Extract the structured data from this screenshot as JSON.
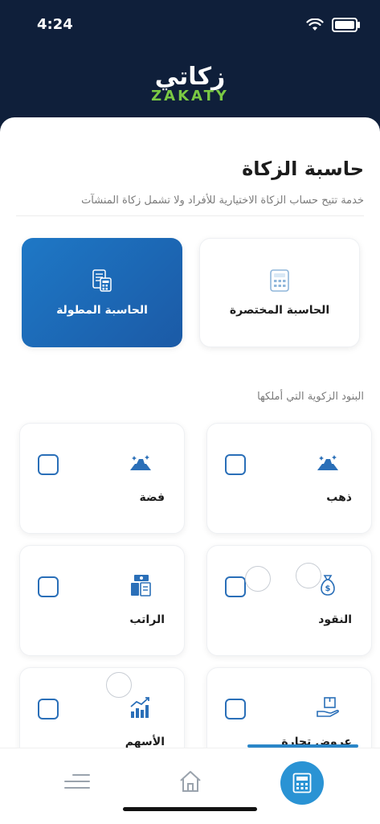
{
  "status_bar": {
    "time": "4:24"
  },
  "logo": {
    "arabic": "زكاتي",
    "english": "ZAKATY"
  },
  "page": {
    "title": "حاسبة الزكاة",
    "subtitle": "خدمة تتيح حساب الزكاة الاختيارية للأفراد ولا تشمل زكاة المنشآت"
  },
  "calculators": [
    {
      "label": "الحاسبة المختصرة",
      "selected": false
    },
    {
      "label": "الحاسبة المطولة",
      "selected": true
    }
  ],
  "section_label": "البنود الزكوية التي أملكها",
  "items": [
    {
      "label": "ذهب",
      "icon": "gold-icon",
      "checked": false
    },
    {
      "label": "فضة",
      "icon": "silver-icon",
      "checked": false
    },
    {
      "label": "النقود",
      "icon": "money-bag-icon",
      "checked": false
    },
    {
      "label": "الراتب",
      "icon": "salary-icon",
      "checked": false
    },
    {
      "label": "عروض تجارة",
      "icon": "trade-goods-icon",
      "checked": false
    },
    {
      "label": "الأسهم",
      "icon": "stocks-icon",
      "checked": false
    }
  ],
  "colors": {
    "header_bg": "#0f1f3a",
    "accent": "#2a93d4",
    "logo_green": "#7ac943",
    "selected_card": "#1e78c6"
  },
  "bottom_nav": [
    {
      "name": "menu-icon"
    },
    {
      "name": "home-icon"
    },
    {
      "name": "calculator-icon",
      "active": true
    }
  ]
}
